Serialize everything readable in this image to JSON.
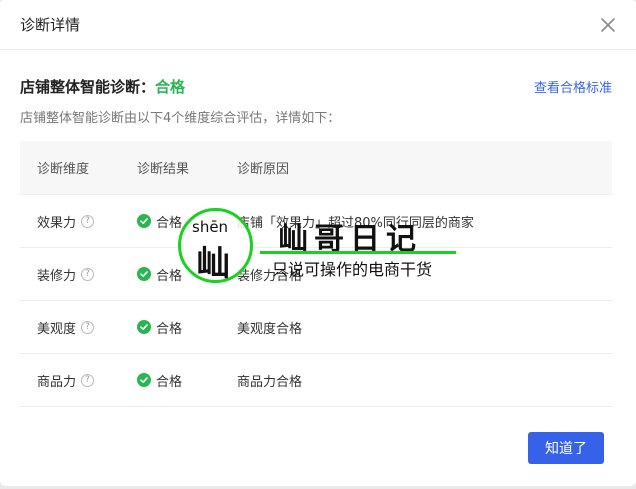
{
  "dialog": {
    "title": "诊断详情",
    "close_icon": "close-icon"
  },
  "summary": {
    "label": "店铺整体智能诊断：",
    "status": "合格",
    "status_color": "#2bb552",
    "criteria_link": "查看合格标准",
    "subtitle": "店铺整体智能诊断由以下4个维度综合评估，详情如下："
  },
  "table": {
    "headers": [
      "诊断维度",
      "诊断结果",
      "诊断原因"
    ],
    "rows": [
      {
        "dimension": "效果力",
        "result": "合格",
        "reason": "店铺「效果力」超过80%同行同层的商家"
      },
      {
        "dimension": "装修力",
        "result": "合格",
        "reason": "装修力合格"
      },
      {
        "dimension": "美观度",
        "result": "合格",
        "reason": "美观度合格"
      },
      {
        "dimension": "商品力",
        "result": "合格",
        "reason": "商品力合格"
      }
    ],
    "help_icon": "question-circle-icon",
    "result_icon": "check-circle-icon"
  },
  "footer": {
    "ok_label": "知道了",
    "ok_color": "#3562e8"
  },
  "watermark": {
    "pinyin": "shēn",
    "char": "屾",
    "title": "屾哥日记",
    "slogan": "只说可操作的电商干货",
    "accent": "#19d11e"
  }
}
